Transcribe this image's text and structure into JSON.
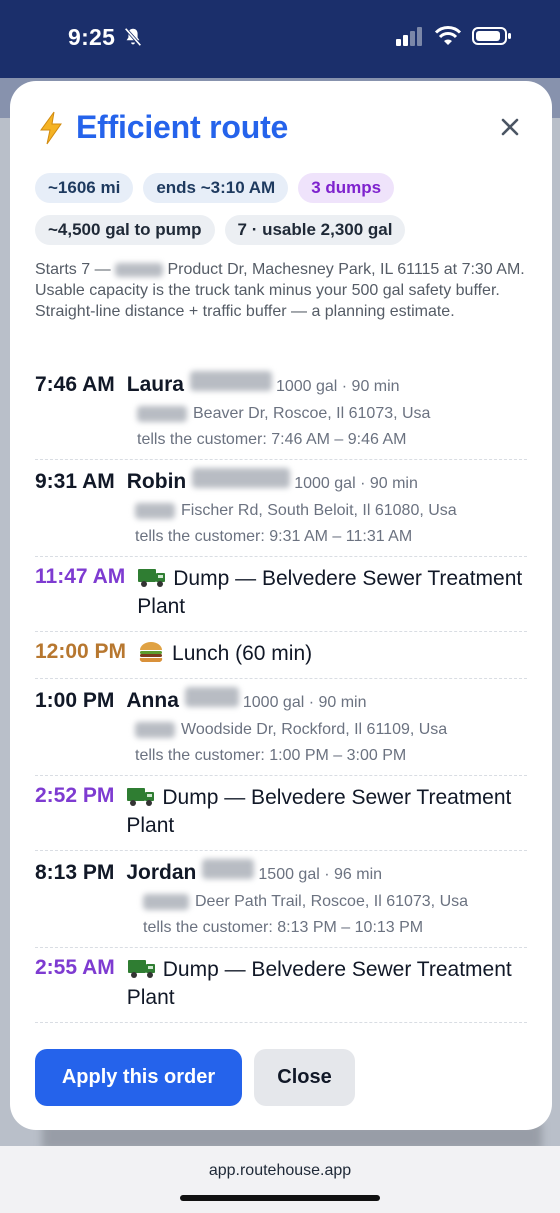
{
  "status": {
    "time": "9:25"
  },
  "modal": {
    "title": "Efficient route",
    "chips_row1": [
      "~1606 mi",
      "ends ~3:10 AM",
      "3 dumps"
    ],
    "chips_row2": [
      "~4,500 gal to pump",
      "7 · usable 2,300 gal"
    ],
    "description": "Starts 7 — ▒▒▒▒▒ Product Dr, Machesney Park, IL 61115 at 7:30 AM. Usable capacity is the truck tank minus your 500 gal safety buffer. Straight-line distance + traffic buffer — a planning estimate.",
    "desc_part1": "Starts 7 —",
    "desc_part2": "Product Dr, Machesney Park, IL 61115 at 7:30 AM. Usable capacity is the truck tank minus your 500 gal safety buffer. Straight-line distance + traffic buffer — a planning estimate.",
    "stops": {
      "s1": {
        "time": "7:46 AM",
        "name": "Laura",
        "meta": "1000 gal · 90 min",
        "addr": "Beaver Dr, Roscoe, Il 61073, Usa",
        "tells": "tells the customer: 7:46 AM – 9:46 AM"
      },
      "s2": {
        "time": "9:31 AM",
        "name": "Robin",
        "meta": "1000 gal · 90 min",
        "addr": "Fischer Rd, South Beloit, Il 61080, Usa",
        "tells": "tells the customer: 9:31 AM – 11:31 AM"
      },
      "d1": {
        "time": "11:47 AM",
        "text": "Dump — Belvedere Sewer Treatment Plant"
      },
      "lunch": {
        "time": "12:00 PM",
        "text": "Lunch (60 min)"
      },
      "s3": {
        "time": "1:00 PM",
        "name": "Anna",
        "meta": "1000 gal · 90 min",
        "addr": "Woodside Dr, Rockford, Il 61109, Usa",
        "tells": "tells the customer: 1:00 PM – 3:00 PM"
      },
      "d2": {
        "time": "2:52 PM",
        "text": "Dump — Belvedere Sewer Treatment Plant"
      },
      "s4": {
        "time": "8:13 PM",
        "name": "Jordan",
        "meta": "1500 gal · 96 min",
        "addr": "Deer Path Trail, Roscoe, Il 61073, Usa",
        "tells": "tells the customer: 8:13 PM – 10:13 PM"
      },
      "d3": {
        "time": "2:55 AM",
        "text": "Dump — Belvedere Sewer Treatment Plant"
      }
    },
    "apply_label": "Apply this order",
    "close_label": "Close"
  },
  "browser": {
    "url": "app.routehouse.app"
  },
  "colors": {
    "accent": "#2563eb",
    "dump": "#7e3bd1",
    "lunch": "#b7772f",
    "statusbar": "#1b2f6b"
  },
  "icons": [
    "bell-slash-icon",
    "cellular-icon",
    "wifi-icon",
    "battery-icon",
    "lightning-icon",
    "close-icon",
    "truck-icon",
    "burger-icon"
  ]
}
